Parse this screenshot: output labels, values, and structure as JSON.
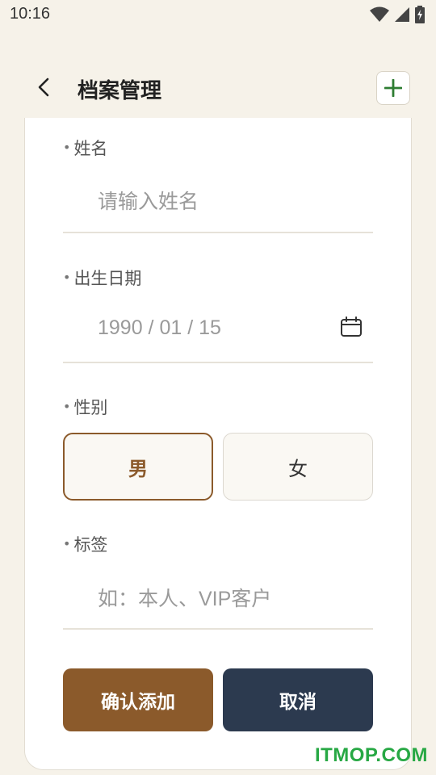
{
  "status_bar": {
    "time": "10:16"
  },
  "header": {
    "title": "档案管理"
  },
  "form": {
    "name_label": "姓名",
    "name_placeholder": "请输入姓名",
    "dob_label": "出生日期",
    "dob_value": "1990 / 01 / 15",
    "gender_label": "性别",
    "gender_options": [
      "男",
      "女"
    ],
    "gender_selected": "男",
    "tags_label": "标签",
    "tags_placeholder": "如：本人、VIP客户"
  },
  "actions": {
    "confirm_label": "确认添加",
    "cancel_label": "取消"
  },
  "watermark": "ITMOP.COM",
  "colors": {
    "accent": "#8b5a2b",
    "dark": "#2c3a4f",
    "background": "#f6f2e9",
    "plus": "#2e7d32"
  }
}
